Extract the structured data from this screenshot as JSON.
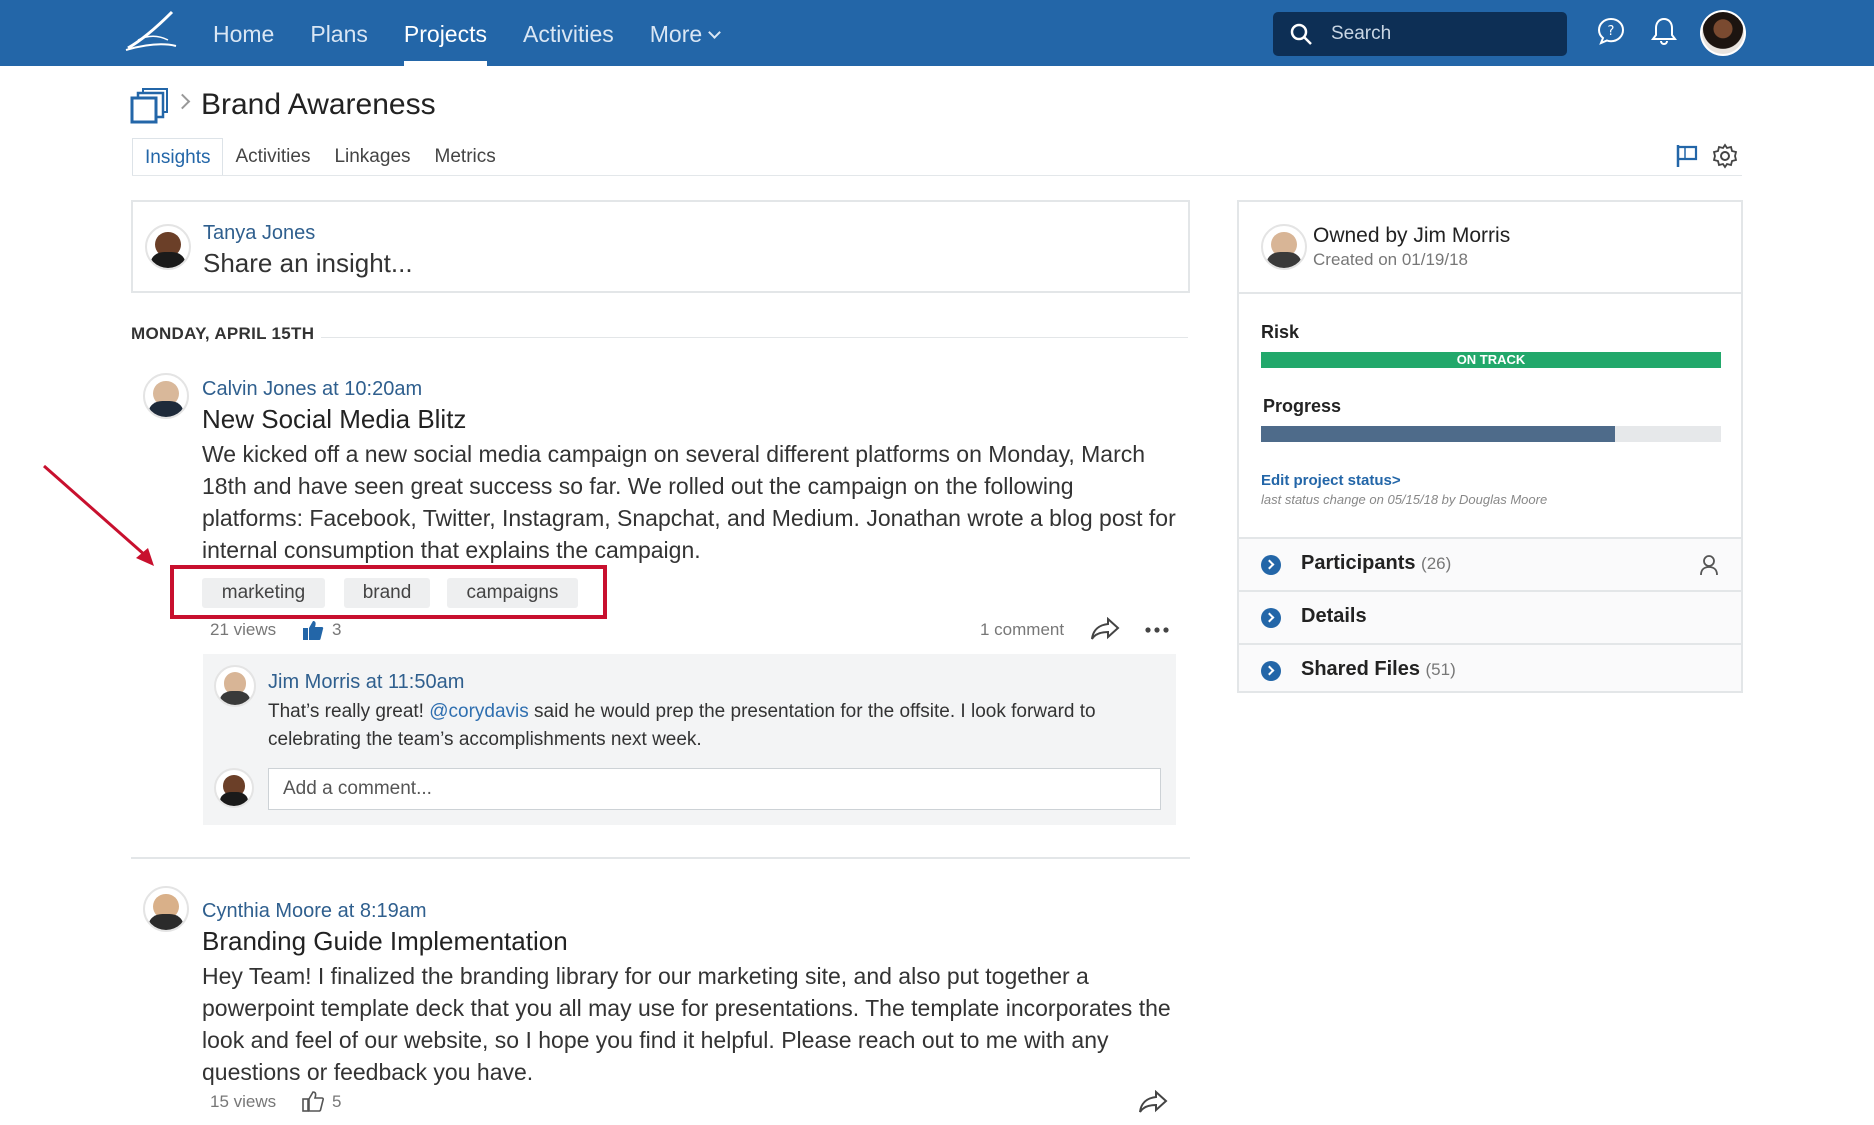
{
  "nav": {
    "items": [
      {
        "label": "Home",
        "active": false
      },
      {
        "label": "Plans",
        "active": false
      },
      {
        "label": "Projects",
        "active": true
      },
      {
        "label": "Activities",
        "active": false
      },
      {
        "label": "More",
        "active": false
      }
    ],
    "search_placeholder": "Search",
    "icons": [
      "logo-icon",
      "search-icon",
      "chat-icon",
      "bell-icon",
      "user-avatar"
    ]
  },
  "project": {
    "title": "Brand Awareness",
    "tabs": [
      {
        "label": "Insights",
        "active": true
      },
      {
        "label": "Activities",
        "active": false
      },
      {
        "label": "Linkages",
        "active": false
      },
      {
        "label": "Metrics",
        "active": false
      }
    ]
  },
  "share": {
    "user": "Tanya Jones",
    "prompt": "Share an insight..."
  },
  "feed": {
    "date_label": "MONDAY, APRIL 15TH",
    "posts": [
      {
        "author_time": "Calvin Jones at 10:20am",
        "title": "New Social Media Blitz",
        "body": "We kicked off a new social media campaign on several different platforms on Monday, March 18th and have seen great success so far. We rolled out the campaign on the following platforms: Facebook, Twitter, Instagram, Snapchat, and Medium. Jonathan wrote a blog post for internal consumption that explains the campaign.",
        "tags": [
          "marketing",
          "brand",
          "campaigns"
        ],
        "views": "21 views",
        "likes": "3",
        "comments_label": "1 comment",
        "comment": {
          "author_time": "Jim Morris at 11:50am",
          "text_before": "That’s really great! ",
          "mention": "@corydavis",
          "text_after": " said he would prep the presentation for the offsite. I look forward to celebrating the team’s accomplishments next week."
        },
        "add_comment_placeholder": "Add a comment..."
      },
      {
        "author_time": "Cynthia Moore at 8:19am",
        "title": "Branding Guide Implementation",
        "body": "Hey Team! I finalized the branding library for our marketing site, and also put together a powerpoint template deck that you all may use for presentations. The template incorporates the look and feel of our website, so I hope you find it helpful. Please reach out to me with any questions or feedback you have.",
        "views": "15 views",
        "likes": "5"
      }
    ]
  },
  "sidebar": {
    "owner": "Owned by Jim Morris",
    "created": "Created on 01/19/18",
    "risk_label": "Risk",
    "risk_status": "ON TRACK",
    "risk_color": "#22a86b",
    "progress_label": "Progress",
    "progress_value": 0.77,
    "edit_status": "Edit project status>",
    "last_change": "last status change on 05/15/18 by Douglas Moore",
    "sections": [
      {
        "label": "Participants",
        "count": "(26)"
      },
      {
        "label": "Details",
        "count": ""
      },
      {
        "label": "Shared Files",
        "count": "(51)"
      }
    ]
  },
  "colors": {
    "brand": "#2366a8",
    "highlight": "#c8102e"
  }
}
